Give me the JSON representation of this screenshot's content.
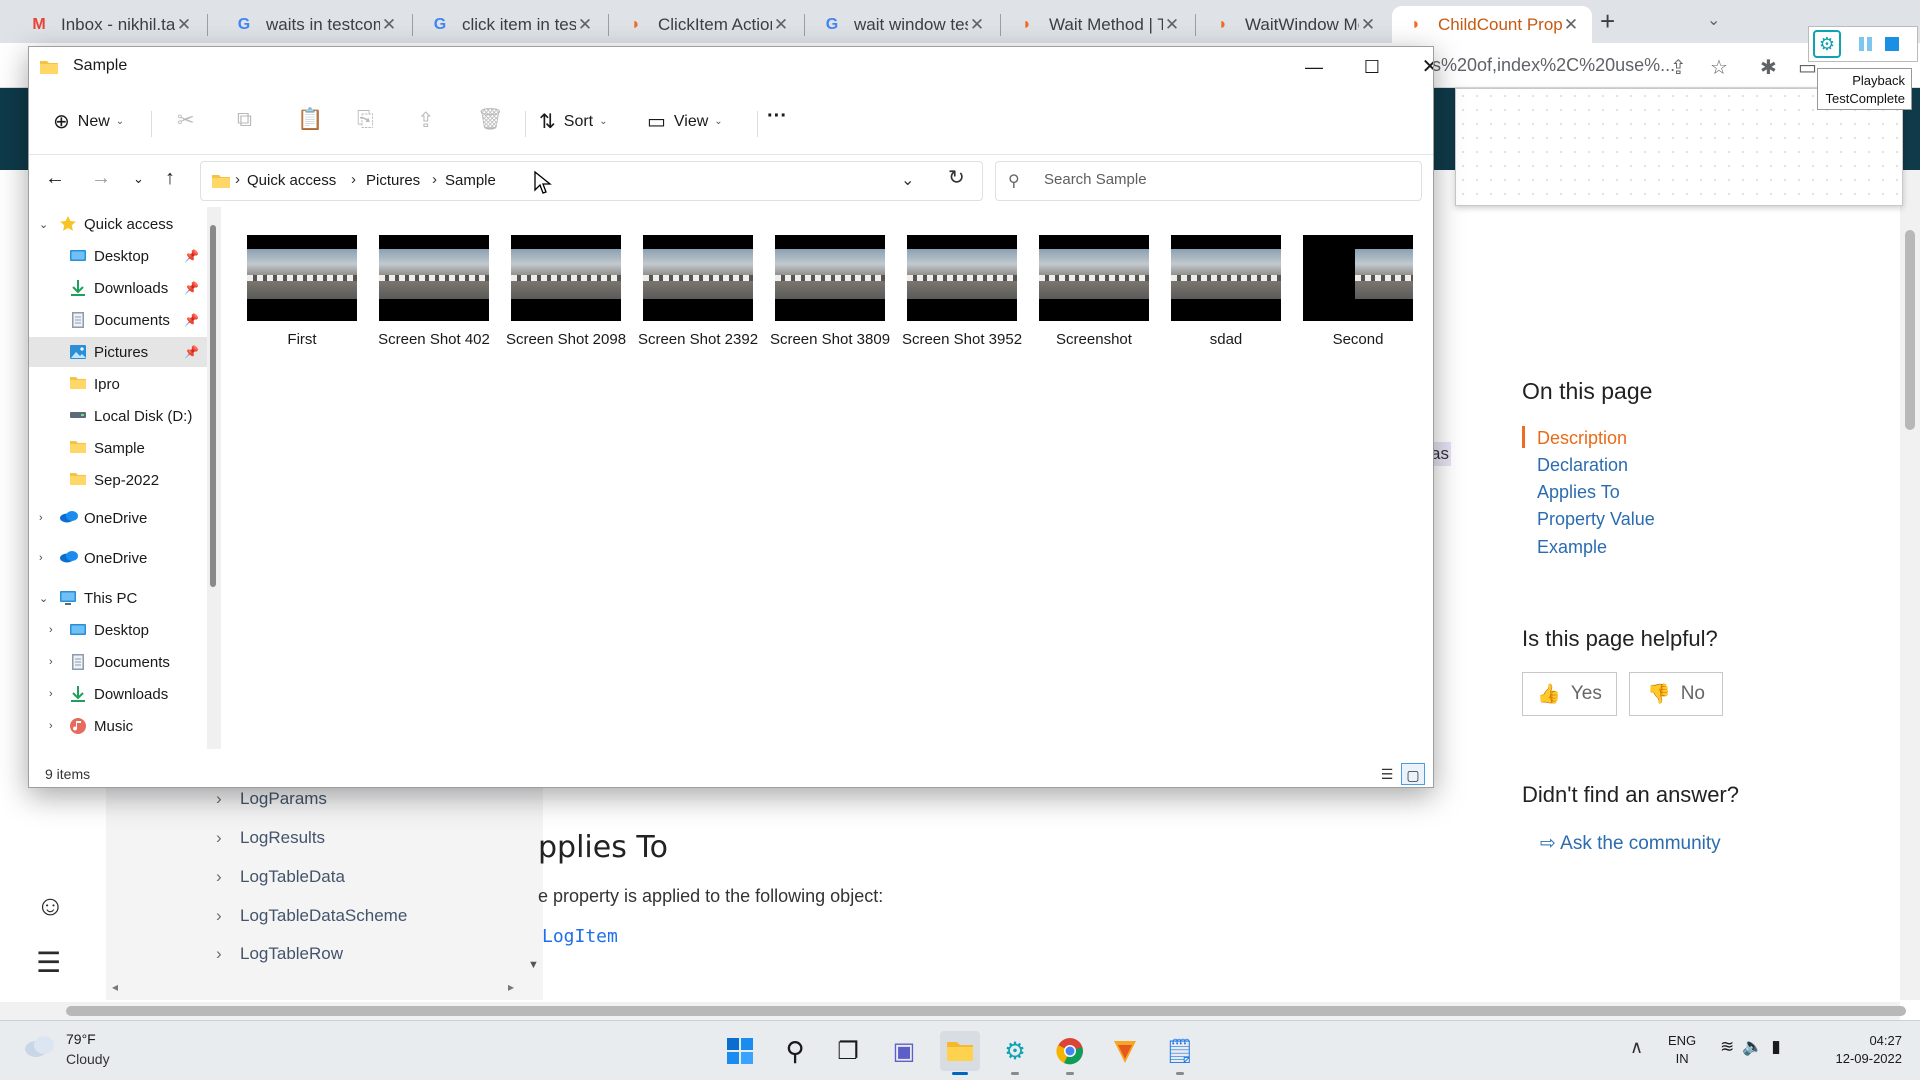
{
  "browser": {
    "tabs": [
      {
        "title": "Inbox - nikhil.tadi",
        "favicon": "gmail-icon",
        "color": "#ea4335",
        "glyph": "M"
      },
      {
        "title": "waits in testcomp",
        "favicon": "google-icon",
        "color": "#4285f4",
        "glyph": "G"
      },
      {
        "title": "click item in test",
        "favicon": "google-icon",
        "color": "#4285f4",
        "glyph": "G"
      },
      {
        "title": "ClickItem Action",
        "favicon": "smartbear-icon",
        "color": "#f26b22",
        "glyph": "◗"
      },
      {
        "title": "wait window test",
        "favicon": "google-icon",
        "color": "#4285f4",
        "glyph": "G"
      },
      {
        "title": "Wait Method | Te",
        "favicon": "smartbear-icon",
        "color": "#f26b22",
        "glyph": "◗"
      },
      {
        "title": "WaitWindow Met",
        "favicon": "smartbear-icon",
        "color": "#f26b22",
        "glyph": "◗"
      },
      {
        "title": "ChildCount Prop",
        "favicon": "smartbear-icon",
        "color": "#f26b22",
        "glyph": "◗"
      }
    ],
    "new_tab": "+",
    "url_tail": "s%20of,index%2C%20use%..."
  },
  "testcomplete": {
    "tooltip_line1": "Playback",
    "tooltip_line2": "TestComplete"
  },
  "page": {
    "nav_items": [
      "LogParams",
      "LogResults",
      "LogTableData",
      "LogTableDataScheme",
      "LogTableRow"
    ],
    "heading_fragment": "pplies To",
    "paragraph_fragment": "e property is applied to the following object:",
    "code_link": "LogItem",
    "highlight_fragment": "as",
    "on_this_page_title": "On this page",
    "on_this_page_links": [
      "Description",
      "Declaration",
      "Applies To",
      "Property Value",
      "Example"
    ],
    "helpful_title": "Is this page helpful?",
    "yes_label": "Yes",
    "no_label": "No",
    "didnt_find_title": "Didn't find an answer?",
    "ask_label": "Ask the community",
    "accent_color": "#f26b22",
    "header_color": "#0f3a4a"
  },
  "explorer": {
    "title": "Sample",
    "commands": {
      "new_label": "New",
      "sort_label": "Sort",
      "view_label": "View",
      "more_label": "···"
    },
    "breadcrumb": [
      "Quick access",
      "Pictures",
      "Sample"
    ],
    "search_placeholder": "Search Sample",
    "tree": [
      {
        "label": "Quick access",
        "level": 0,
        "icon": "star-icon",
        "expanded": true
      },
      {
        "label": "Desktop",
        "level": 1,
        "icon": "desktop-icon",
        "pinned": true
      },
      {
        "label": "Downloads",
        "level": 1,
        "icon": "downloads-icon",
        "pinned": true
      },
      {
        "label": "Documents",
        "level": 1,
        "icon": "documents-icon",
        "pinned": true
      },
      {
        "label": "Pictures",
        "level": 1,
        "icon": "pictures-icon",
        "pinned": true,
        "selected": true
      },
      {
        "label": "Ipro",
        "level": 1,
        "icon": "folder-icon"
      },
      {
        "label": "Local Disk (D:)",
        "level": 1,
        "icon": "drive-icon"
      },
      {
        "label": "Sample",
        "level": 1,
        "icon": "folder-icon"
      },
      {
        "label": "Sep-2022",
        "level": 1,
        "icon": "folder-icon"
      },
      {
        "label": "OneDrive",
        "level": 0,
        "icon": "onedrive-icon",
        "expanded": false
      },
      {
        "label": "OneDrive",
        "level": 0,
        "icon": "onedrive-icon",
        "expanded": false
      },
      {
        "label": "This PC",
        "level": 0,
        "icon": "pc-icon",
        "expanded": true
      },
      {
        "label": "Desktop",
        "level": 1,
        "icon": "desktop-icon",
        "expanded": false
      },
      {
        "label": "Documents",
        "level": 1,
        "icon": "documents-icon",
        "expanded": false
      },
      {
        "label": "Downloads",
        "level": 1,
        "icon": "downloads-icon",
        "expanded": false
      },
      {
        "label": "Music",
        "level": 1,
        "icon": "music-icon",
        "expanded": false
      }
    ],
    "files": [
      {
        "name": "First",
        "partial": false
      },
      {
        "name": "Screen Shot 402",
        "partial": false
      },
      {
        "name": "Screen Shot 2098",
        "partial": false
      },
      {
        "name": "Screen Shot 2392",
        "partial": false
      },
      {
        "name": "Screen Shot 3809",
        "partial": false
      },
      {
        "name": "Screen Shot 3952",
        "partial": false
      },
      {
        "name": "Screenshot",
        "partial": false
      },
      {
        "name": "sdad",
        "partial": false
      },
      {
        "name": "Second",
        "partial": true
      }
    ],
    "status": "9 items"
  },
  "taskbar": {
    "weather_temp": "79°F",
    "weather_cond": "Cloudy",
    "lang_line1": "ENG",
    "lang_line2": "IN",
    "time": "04:27",
    "date": "12-09-2022"
  }
}
